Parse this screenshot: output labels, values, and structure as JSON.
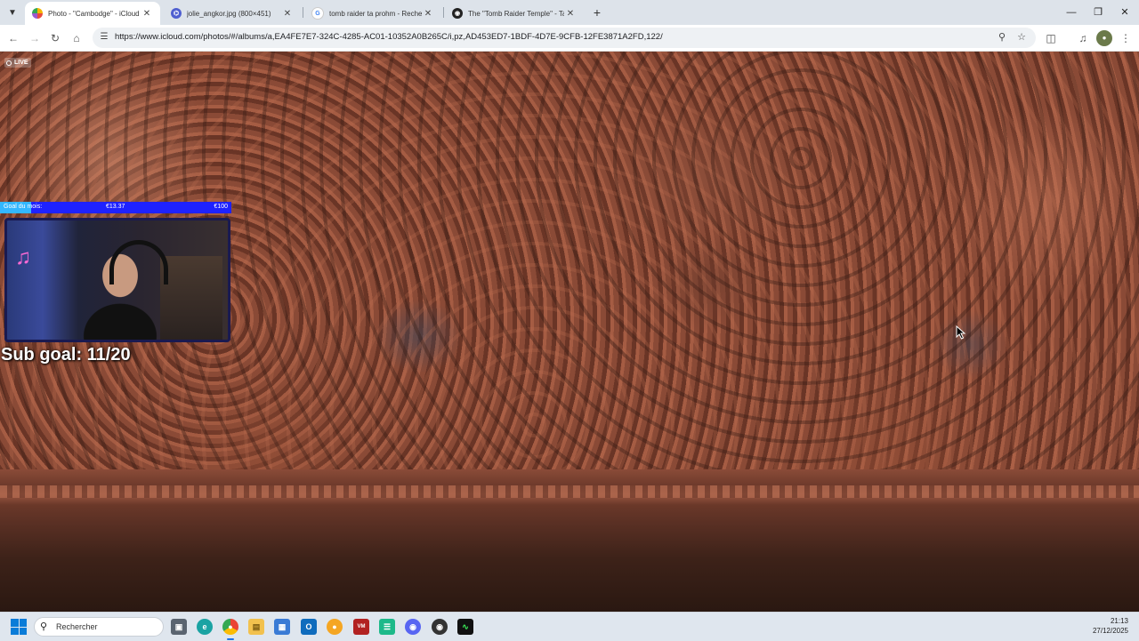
{
  "browser": {
    "tabs": [
      {
        "title": "Photo - \"Cambodge\" - iCloud P",
        "favicon": "icloud-photos-icon",
        "active": true
      },
      {
        "title": "jolie_angkor.jpg (800×451)",
        "favicon": "image-icon",
        "active": false
      },
      {
        "title": "tomb raider ta prohm - Recherc",
        "favicon": "google-icon",
        "active": false
      },
      {
        "title": "The \"Tomb Raider Temple\" - Ta",
        "favicon": "site-icon",
        "active": false
      }
    ],
    "url": "https://www.icloud.com/photos/#/albums/a,EA4FE7E7-324C-4285-AC01-10352A0B265C/i,pz,AD453ED7-1BDF-4D7E-9CFB-12FE3871A2FD,122/"
  },
  "photo": {
    "live_badge": "LIVE"
  },
  "stream_overlay": {
    "goal_label": "Goal du mois:",
    "goal_current": "€13.37",
    "goal_target": "€100",
    "goal_progress": 0.1337,
    "sub_goal": "Sub goal: 11/20"
  },
  "taskbar": {
    "search_placeholder": "Rechercher",
    "time": "21:13",
    "date": "27/12/2025"
  }
}
